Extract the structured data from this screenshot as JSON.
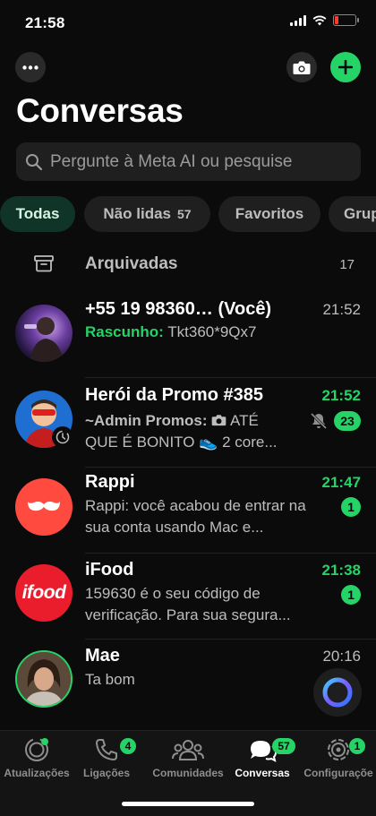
{
  "status_bar": {
    "time": "21:58"
  },
  "header": {
    "title": "Conversas",
    "more_icon": "ellipsis-icon",
    "camera_icon": "camera-icon",
    "new_chat_icon": "plus-icon"
  },
  "search": {
    "placeholder": "Pergunte à Meta AI ou pesquise"
  },
  "filters": [
    {
      "label": "Todas",
      "count": "",
      "active": true
    },
    {
      "label": "Não lidas",
      "count": "57",
      "active": false
    },
    {
      "label": "Favoritos",
      "count": "",
      "active": false
    },
    {
      "label": "Grup",
      "count": "",
      "active": false
    }
  ],
  "archived": {
    "label": "Arquivadas",
    "count": "17"
  },
  "chats": [
    {
      "name": "+55 19 98360…  (Você)",
      "time": "21:52",
      "draft_label": "Rascunho:",
      "preview": "Tkt360*9Qx7"
    },
    {
      "name": "Herói da Promo #385",
      "time": "21:52",
      "preview_sender": "~Admin Promos:",
      "preview_line1": "ATÉ",
      "preview_line2": "QUE É BONITO 👟 2 core...",
      "badge": "23"
    },
    {
      "name": "Rappi",
      "time": "21:47",
      "preview": "Rappi: você acabou de entrar na sua conta usando Mac e...",
      "badge": "1"
    },
    {
      "name": "iFood",
      "time": "21:38",
      "preview": "159630 é o seu código de verificação. Para sua segura...",
      "badge": "1",
      "logo_text": "ifood"
    },
    {
      "name": "Mae",
      "time": "20:16",
      "preview": "Ta bom"
    }
  ],
  "tabbar": [
    {
      "label": "Atualizações",
      "icon": "updates-icon",
      "badge": ""
    },
    {
      "label": "Ligações",
      "icon": "phone-icon",
      "badge": "4"
    },
    {
      "label": "Comunidades",
      "icon": "communities-icon",
      "badge": ""
    },
    {
      "label": "Conversas",
      "icon": "chats-icon",
      "badge": "57",
      "active": true
    },
    {
      "label": "Configuraçõe",
      "icon": "settings-icon",
      "badge": "1"
    }
  ],
  "colors": {
    "accent": "#25d366",
    "background": "#0b0b0b",
    "chip_active_bg": "#103528"
  }
}
